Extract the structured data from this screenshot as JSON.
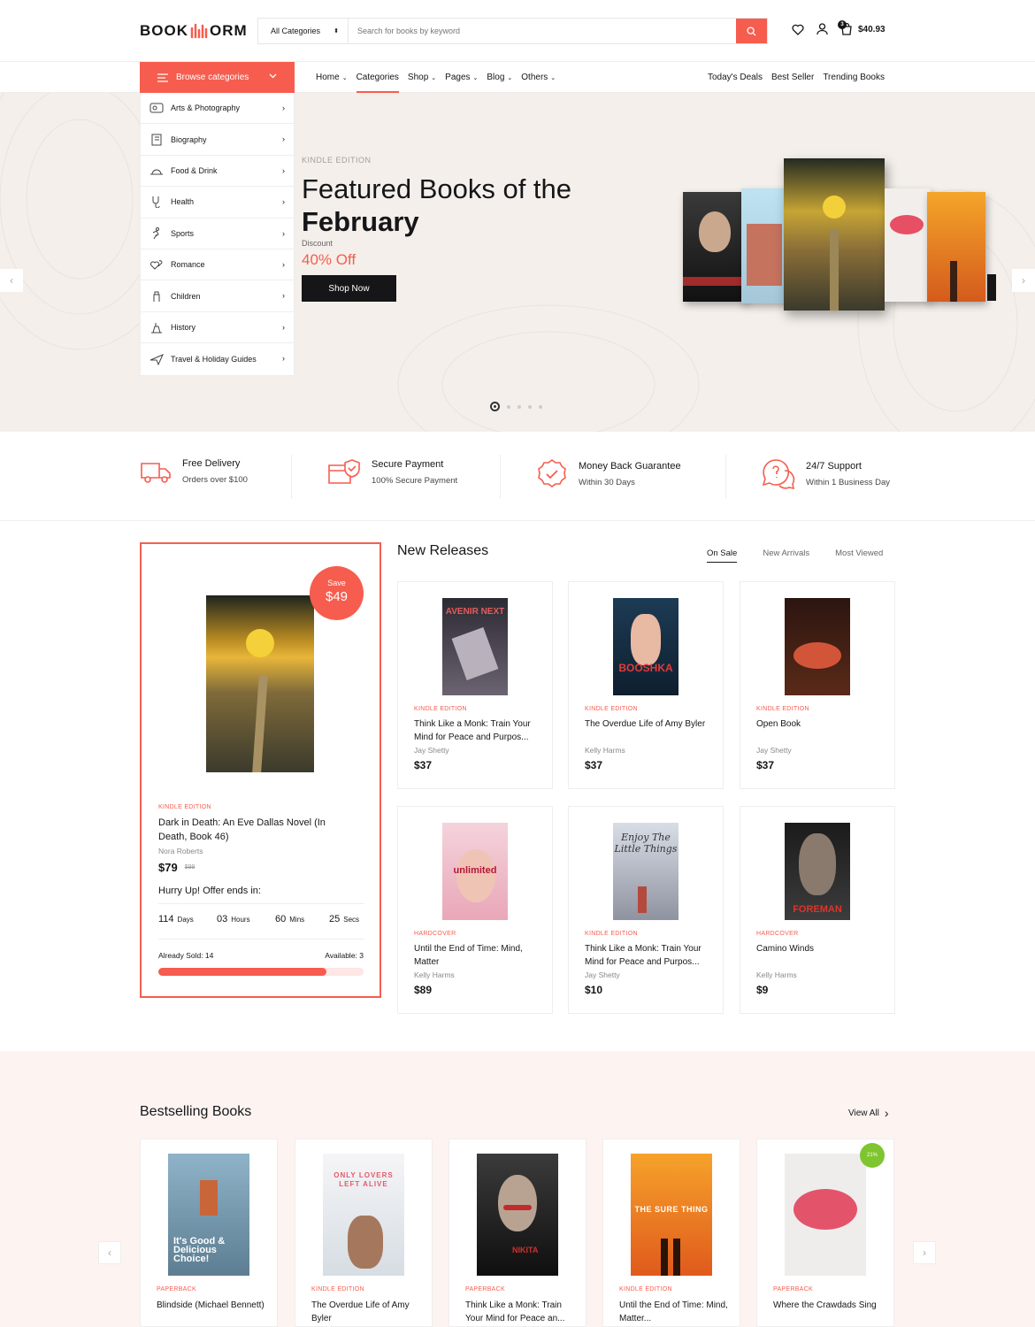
{
  "header": {
    "logo_left": "BOOK",
    "logo_right": "ORM",
    "category_select": "All Categories",
    "search_placeholder": "Search for books by keyword",
    "cart_count": "3",
    "cart_total": "$40.93"
  },
  "nav": {
    "browse_label": "Browse categories",
    "menu": [
      "Home",
      "Categories",
      "Shop",
      "Pages",
      "Blog",
      "Others"
    ],
    "right_links": [
      "Today's Deals",
      "Best Seller",
      "Trending Books"
    ]
  },
  "categories": [
    {
      "label": "Arts & Photography",
      "icon": "palette-icon"
    },
    {
      "label": "Biography",
      "icon": "book-icon"
    },
    {
      "label": "Food & Drink",
      "icon": "food-icon"
    },
    {
      "label": "Health",
      "icon": "health-icon"
    },
    {
      "label": "Sports",
      "icon": "sports-icon"
    },
    {
      "label": "Romance",
      "icon": "romance-icon"
    },
    {
      "label": "Children",
      "icon": "children-icon"
    },
    {
      "label": "History",
      "icon": "history-icon"
    },
    {
      "label": "Travel & Holiday Guides",
      "icon": "plane-icon"
    }
  ],
  "hero": {
    "eyebrow": "KINDLE EDITION",
    "title_line1": "Featured Books of the",
    "title_line2": "February",
    "discount_label": "Discount",
    "discount_value": "40% Off",
    "button": "Shop Now"
  },
  "features": [
    {
      "title": "Free Delivery",
      "sub": "Orders over $100"
    },
    {
      "title": "Secure Payment",
      "sub": "100% Secure Payment"
    },
    {
      "title": "Money Back Guarantee",
      "sub": "Within 30 Days"
    },
    {
      "title": "24/7 Support",
      "sub": "Within 1 Business Day"
    }
  ],
  "deal": {
    "save_label": "Save",
    "save_amount": "$49",
    "format": "KINDLE EDITION",
    "title": "Dark in Death: An Eve Dallas Novel (In Death, Book 46)",
    "author": "Nora Roberts",
    "price": "$79",
    "old_price": "$99",
    "hurry": "Hurry Up! Offer ends in:",
    "countdown": [
      {
        "value": "114",
        "unit": "Days"
      },
      {
        "value": "03",
        "unit": "Hours"
      },
      {
        "value": "60",
        "unit": "Mins"
      },
      {
        "value": "25",
        "unit": "Secs"
      }
    ],
    "sold": "Already Sold: 14",
    "available": "Available: 3",
    "sold_fraction": 0.82
  },
  "new_releases": {
    "title": "New Releases",
    "tabs": [
      "On Sale",
      "New Arrivals",
      "Most Viewed"
    ],
    "products": [
      {
        "format": "KINDLE EDITION",
        "title": "Think Like a Monk: Train Your Mind for Peace and Purpos...",
        "author": "Jay Shetty",
        "price": "$37",
        "cover_text": "AVENIR NEXT"
      },
      {
        "format": "KINDLE EDITION",
        "title": "The Overdue Life of Amy Byler",
        "author": "Kelly Harms",
        "price": "$37",
        "cover_text": "BOOSHKA"
      },
      {
        "format": "KINDLE EDITION",
        "title": "Open Book",
        "author": "Jay Shetty",
        "price": "$37",
        "cover_text": ""
      },
      {
        "format": "HARDCOVER",
        "title": "Until the End of Time: Mind, Matter",
        "author": "Kelly Harms",
        "price": "$89",
        "cover_text": "unlimited"
      },
      {
        "format": "KINDLE EDITION",
        "title": "Think Like a Monk: Train Your Mind for Peace and Purpos...",
        "author": "Jay Shetty",
        "price": "$10",
        "cover_text": "Enjoy The Little Things"
      },
      {
        "format": "HARDCOVER",
        "title": "Camino Winds",
        "author": "Kelly Harms",
        "price": "$9",
        "cover_text": "FOREMAN"
      }
    ]
  },
  "bestselling": {
    "title": "Bestselling Books",
    "view_all": "View All",
    "products": [
      {
        "format": "PAPERBACK",
        "title": "Blindside (Michael Bennett)",
        "cover_text": "It's Good & Delicious Choice!"
      },
      {
        "format": "KINDLE EDITION",
        "title": "The Overdue Life of Amy Byler",
        "cover_text": "ONLY LOVERS LEFT ALIVE"
      },
      {
        "format": "PAPERBACK",
        "title": "Think Like a Monk: Train Your Mind for Peace an...",
        "cover_text": "NIKITA"
      },
      {
        "format": "KINDLE EDITION",
        "title": "Until the End of Time: Mind, Matter...",
        "cover_text": "THE SURE THING"
      },
      {
        "format": "PAPERBACK",
        "title": "Where the Crawdads Sing",
        "cover_text": "",
        "badge": "21%"
      }
    ]
  },
  "colors": {
    "accent": "#f65d4e",
    "dark": "#161619",
    "hero_bg": "#f4efeb",
    "best_bg": "#fdf3f1"
  }
}
